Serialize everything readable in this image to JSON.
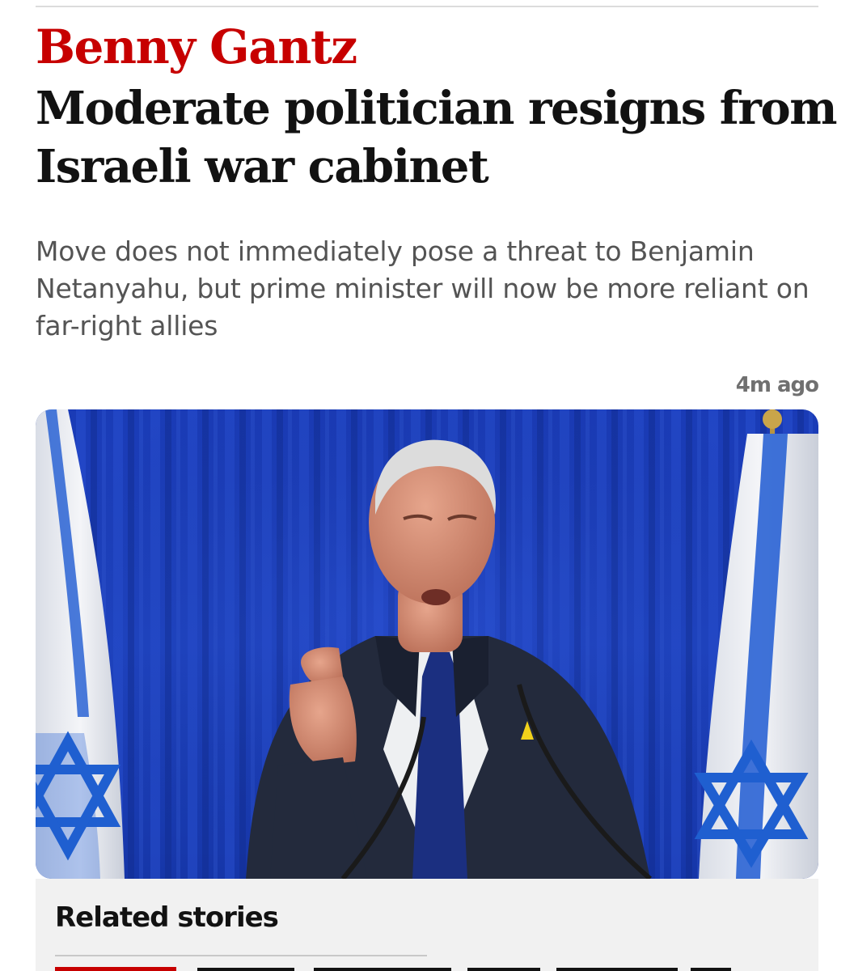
{
  "article": {
    "kicker": "Benny Gantz",
    "headline": "Moderate politician resigns from Israeli war cabinet",
    "standfirst": "Move does not immediately pose a threat to Benjamin Netanyahu, but prime minister will now be more reliant on far-right allies",
    "timestamp": "4m ago"
  },
  "related": {
    "title": "Related stories"
  },
  "colors": {
    "kicker": "#c70000",
    "headline": "#121212",
    "standfirst": "#545454",
    "timestamp": "#707070",
    "curtain": "#1c3fb8",
    "flag_blue": "#1f5fd0",
    "suit": "#232a3c",
    "tie": "#1b2f80"
  },
  "icons": {
    "flag_emblem": "star-of-david-icon"
  }
}
